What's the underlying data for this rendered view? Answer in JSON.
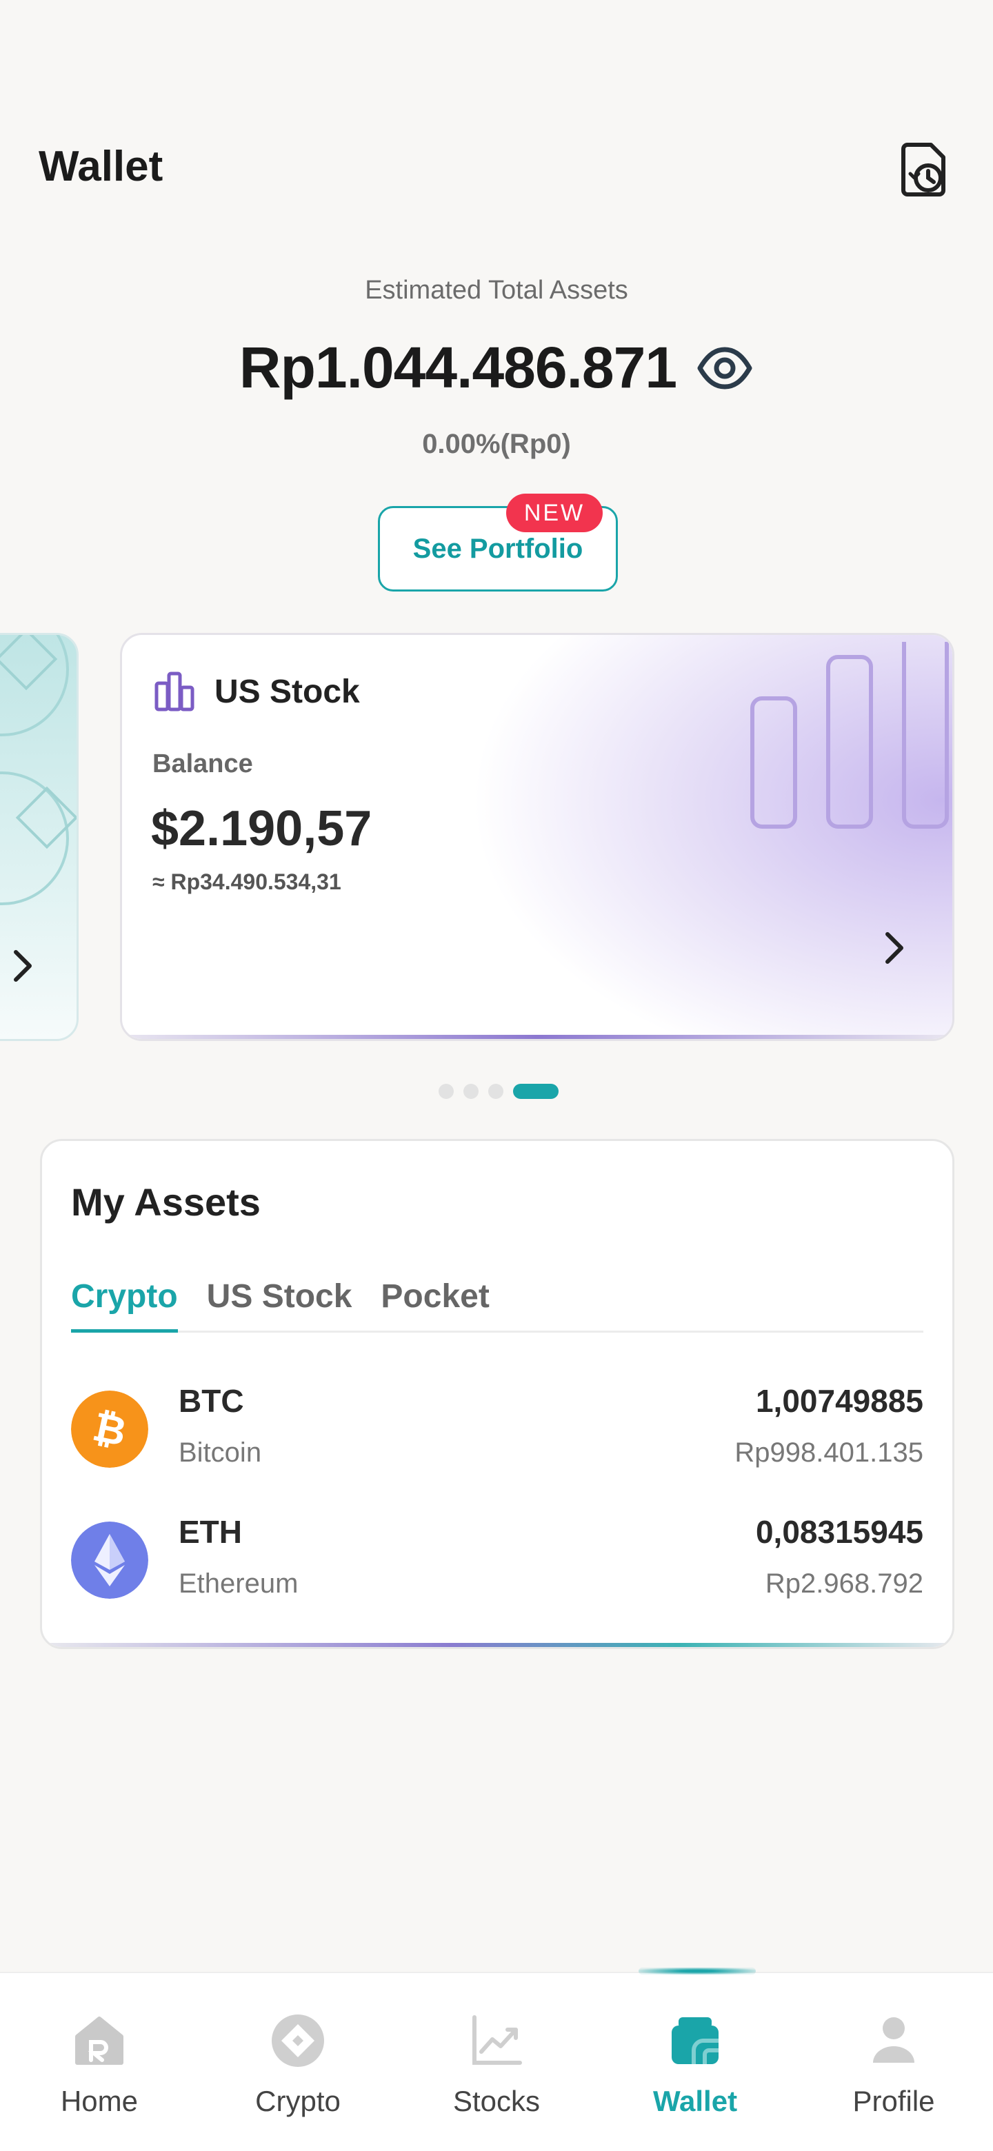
{
  "header": {
    "title": "Wallet",
    "history_icon": "document-history-icon"
  },
  "summary": {
    "label": "Estimated Total Assets",
    "total": "Rp1.044.486.871",
    "change": "0.00%(Rp0)",
    "portfolio_button": "See Portfolio",
    "new_badge": "NEW"
  },
  "carousel": {
    "card": {
      "title": "US Stock",
      "balance_label": "Balance",
      "balance": "$2.190,57",
      "balance_idr": "≈ Rp34.490.534,31"
    },
    "page_count": 4,
    "active_index": 3
  },
  "assets": {
    "title": "My Assets",
    "tabs": [
      "Crypto",
      "US Stock",
      "Pocket"
    ],
    "active_tab": "Crypto",
    "items": [
      {
        "symbol": "BTC",
        "name": "Bitcoin",
        "amount": "1,00749885",
        "value": "Rp998.401.135",
        "color": "#f7931a"
      },
      {
        "symbol": "ETH",
        "name": "Ethereum",
        "amount": "0,08315945",
        "value": "Rp2.968.792",
        "color": "#6f7fe8"
      }
    ]
  },
  "nav": {
    "items": [
      {
        "label": "Home",
        "icon": "home-icon"
      },
      {
        "label": "Crypto",
        "icon": "crypto-icon"
      },
      {
        "label": "Stocks",
        "icon": "stocks-icon"
      },
      {
        "label": "Wallet",
        "icon": "wallet-icon"
      },
      {
        "label": "Profile",
        "icon": "profile-icon"
      }
    ],
    "active": "Wallet"
  },
  "colors": {
    "accent": "#1aa5a9",
    "badge": "#f2344e",
    "stock_purple": "#7b5cc4"
  }
}
